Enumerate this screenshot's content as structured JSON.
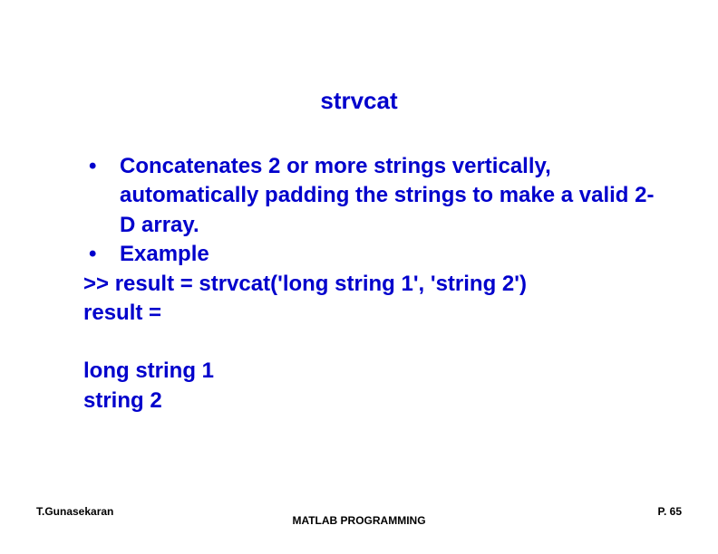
{
  "title": "strvcat",
  "bullets": [
    "Concatenates 2 or more strings vertically, automatically padding the strings to make a valid 2-D array.",
    "Example"
  ],
  "lines": {
    "cmd": ">> result = strvcat('long string 1', 'string 2')",
    "res_label": "result =",
    "out1": "long string 1",
    "out2": "string 2"
  },
  "footer": {
    "author": "T.Gunasekaran",
    "center": "MATLAB PROGRAMMING",
    "page": "P. 65"
  }
}
